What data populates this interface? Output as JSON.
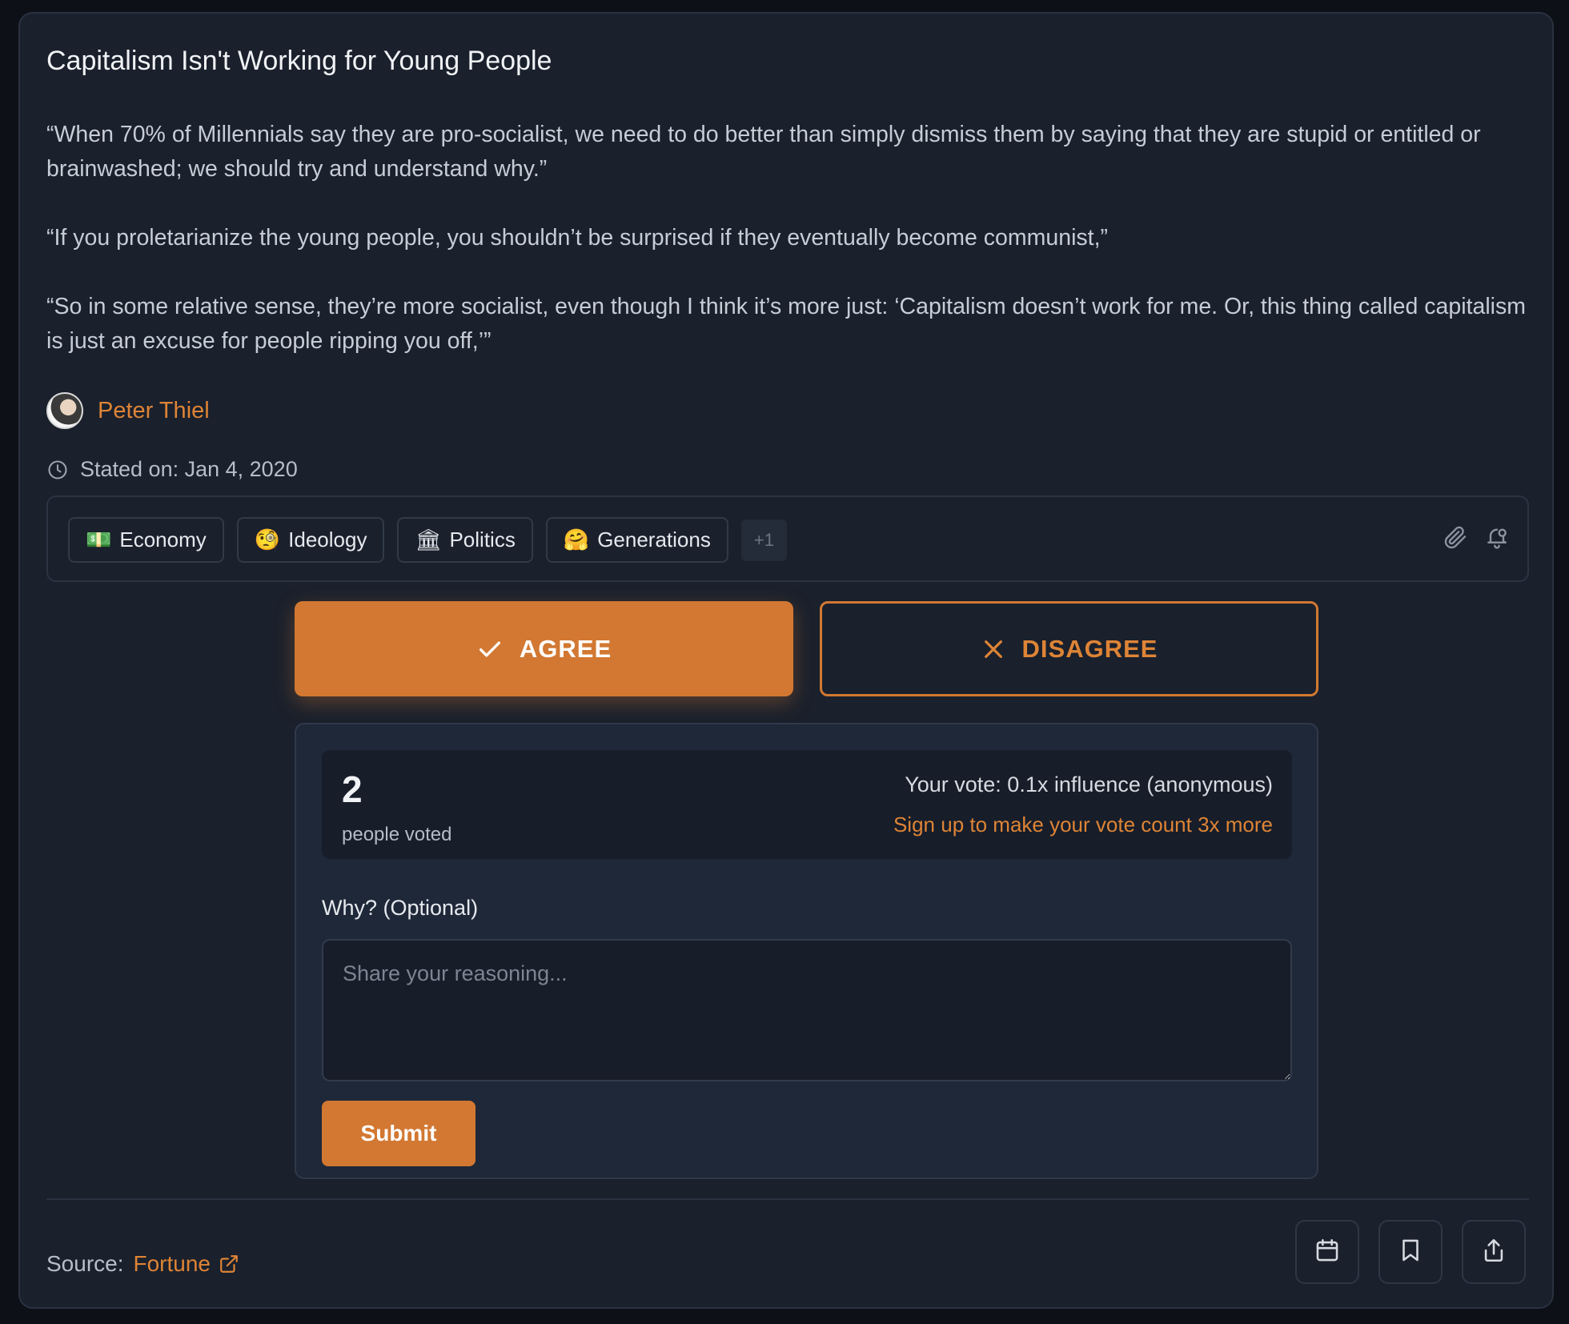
{
  "claim": {
    "title": "Capitalism Isn't Working for Young People",
    "quotes": [
      "“When 70% of Millennials say they are pro-socialist, we need to do better than simply dismiss them by saying that they are stupid or entitled or brainwashed; we should try and understand why.”",
      "“If you proletarianize the young people, you shouldn’t be surprised if they eventually become communist,”",
      "“So in some relative sense, they’re more socialist, even though I think it’s more just: ‘Capitalism doesn’t work for me. Or, this thing called capitalism is just an excuse for people ripping you off,’”"
    ],
    "author": "Peter Thiel",
    "stated_label": "Stated on: Jan 4, 2020"
  },
  "tags": {
    "items": [
      {
        "emoji": "💵",
        "label": "Economy"
      },
      {
        "emoji": "🧐",
        "label": "Ideology"
      },
      {
        "emoji": "🏛",
        "label": "Politics"
      },
      {
        "emoji": "🤗",
        "label": "Generations"
      }
    ],
    "more": "+1",
    "action_icons": [
      "paperclip-icon",
      "bell-plus-icon"
    ]
  },
  "vote": {
    "agree_label": "AGREE",
    "disagree_label": "DISAGREE",
    "count": "2",
    "count_label": "people voted",
    "your_vote": "Your vote: 0.1x influence (anonymous)",
    "signup_text": "Sign up to make your vote count 3x more",
    "why_label": "Why? (Optional)",
    "reason_placeholder": "Share your reasoning...",
    "submit_label": "Submit"
  },
  "footer": {
    "source_label": "Source:",
    "source_name": "Fortune",
    "action_icons": [
      "calendar-icon",
      "bookmark-icon",
      "share-icon"
    ]
  },
  "colors": {
    "accent": "#d27832",
    "background": "#1a202c",
    "panel": "#1f2838"
  }
}
